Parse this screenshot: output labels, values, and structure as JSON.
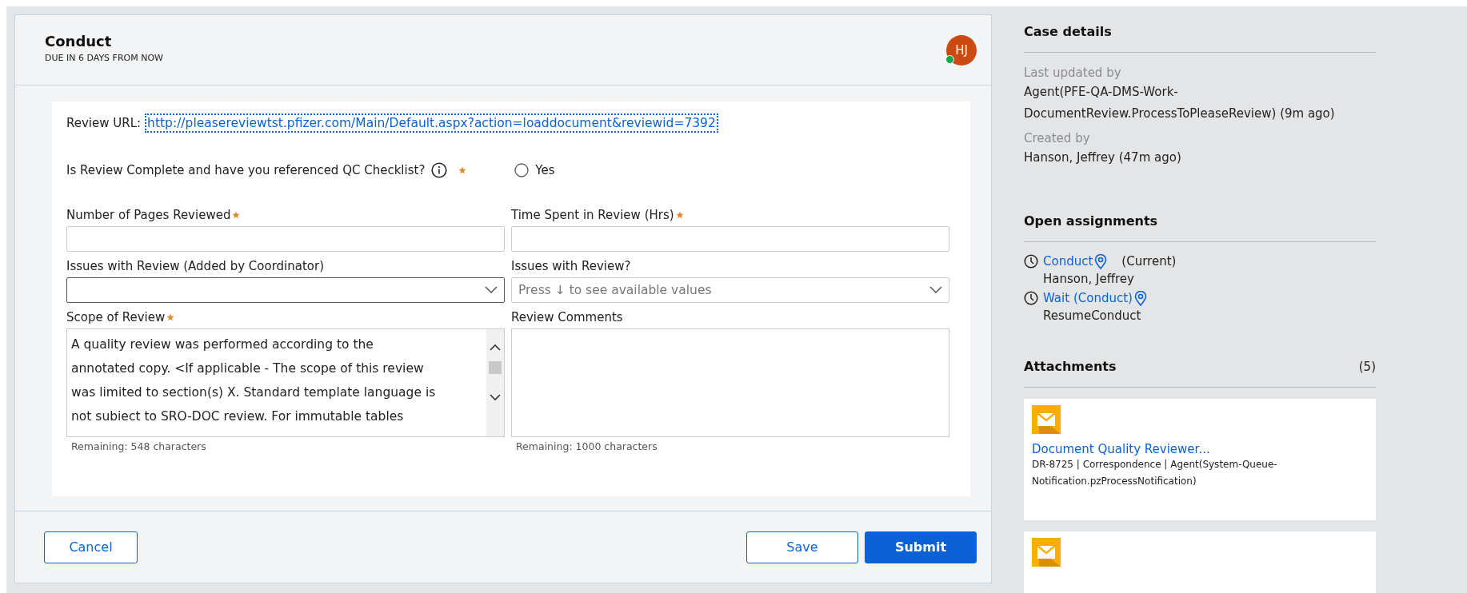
{
  "task": {
    "title": "Conduct",
    "due": "DUE IN 6 DAYS FROM NOW",
    "avatar": {
      "initials": "HJ",
      "online": true
    }
  },
  "form": {
    "review_url": {
      "label": "Review URL:",
      "link": "http://pleasereviewtst.pfizer.com/Main/Default.aspx?action=loaddocument&reviewid=7392"
    },
    "question": {
      "label": "Is Review Complete and have you referenced QC Checklist?",
      "required": true,
      "options": [
        {
          "label": "Yes",
          "selected": false
        }
      ]
    },
    "fields": [
      {
        "kind": "text",
        "label": "Number of Pages Reviewed",
        "required": true
      },
      {
        "kind": "text",
        "label": "Time Spent in Review (Hrs)",
        "required": true
      },
      {
        "kind": "select",
        "label": "Issues with Review (Added by Coordinator)",
        "required": false,
        "focused": true
      },
      {
        "kind": "select",
        "label": "Issues with Review?",
        "required": false,
        "focused": false,
        "placeholder": "Press ↓ to see available values"
      },
      {
        "kind": "textarea",
        "label": "Scope of Review",
        "required": true,
        "lines": [
          "A quality review was performed according to the",
          "annotated copy. <If applicable - The scope of this review",
          "was limited to section(s) X. Standard template language is",
          "not subiect to SRO-DOC review. For immutable tables"
        ],
        "remaining": "Remaining: 548 characters"
      },
      {
        "kind": "textarea",
        "label": "Review Comments",
        "required": false,
        "remaining": "Remaining: 1000 characters"
      }
    ]
  },
  "actions": {
    "cancel": "Cancel",
    "save": "Save",
    "submit": "Submit"
  },
  "case_details": {
    "title": "Case details",
    "entries": [
      {
        "label": "Last updated by",
        "value": "Agent(PFE-QA-DMS-Work-DocumentReview.ProcessToPleaseReview) (9m ago)"
      },
      {
        "label": "Created by",
        "value": "Hanson, Jeffrey (47m ago)"
      }
    ]
  },
  "open_assignments": {
    "title": "Open assignments",
    "items": [
      {
        "name": "Conduct",
        "tag": "(Current)",
        "assignee": "Hanson, Jeffrey"
      },
      {
        "name": "Wait (Conduct)",
        "assignee": "ResumeConduct"
      }
    ]
  },
  "attachments": {
    "title": "Attachments",
    "count": "(5)",
    "items": [
      {
        "kind": "email",
        "title": "Document Quality Reviewer...",
        "meta": "DR-8725 | Correspondence | Agent(System-Queue-Notification.pzProcessNotification)"
      },
      {
        "kind": "email"
      }
    ]
  }
}
